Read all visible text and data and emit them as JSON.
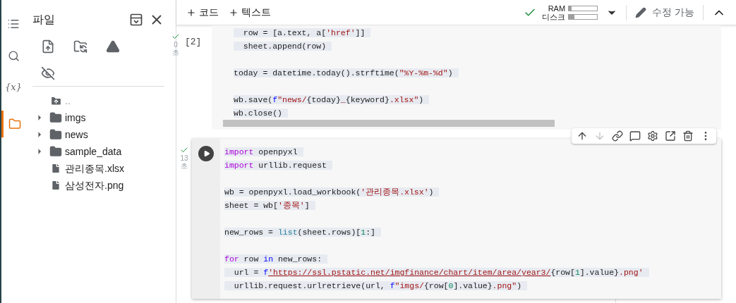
{
  "rail": [
    {
      "kind": "toc",
      "selected": false
    },
    {
      "kind": "search",
      "selected": false
    },
    {
      "kind": "variables",
      "label": "{x}",
      "selected": false
    },
    {
      "kind": "files",
      "selected": true
    }
  ],
  "files_panel": {
    "title": "파일",
    "tree": [
      {
        "kind": "parent",
        "name": ".."
      },
      {
        "kind": "folder",
        "name": "imgs",
        "expanded": false
      },
      {
        "kind": "folder",
        "name": "news",
        "expanded": false
      },
      {
        "kind": "folder",
        "name": "sample_data",
        "expanded": false
      },
      {
        "kind": "file",
        "name": "관리종목.xlsx"
      },
      {
        "kind": "file",
        "name": "삼성전자.png"
      }
    ]
  },
  "toolbar": {
    "add_code": "코드",
    "add_text": "텍스트",
    "connected": true,
    "ram": {
      "label": "RAM",
      "level": 0.1
    },
    "disk": {
      "label": "디스크",
      "level": 0.2
    },
    "editing": "수정 가능"
  },
  "cells": [
    {
      "status": "0초",
      "done": true,
      "exec_count": "[2]",
      "focused": false,
      "lines": [
        {
          "kind": "code",
          "tokens": [
            {
              "kind": "plain",
              "t": "  row = [a.text, a["
            },
            {
              "kind": "str",
              "t": "'href'"
            },
            {
              "kind": "plain",
              "t": "]]"
            }
          ]
        },
        {
          "kind": "code",
          "tokens": [
            {
              "kind": "plain",
              "t": "  sheet.append(row)"
            }
          ]
        },
        {
          "kind": "blank"
        },
        {
          "kind": "code",
          "tokens": [
            {
              "kind": "plain",
              "t": "today = datetime.today().strftime("
            },
            {
              "kind": "str",
              "t": "\"%Y-%m-%d\""
            },
            {
              "kind": "plain",
              "t": ")"
            }
          ]
        },
        {
          "kind": "blank"
        },
        {
          "kind": "code",
          "tokens": [
            {
              "kind": "plain",
              "t": "wb.save("
            },
            {
              "kind": "kw2",
              "t": "f"
            },
            {
              "kind": "str",
              "t": "\"news/"
            },
            {
              "kind": "plain",
              "t": "{today}"
            },
            {
              "kind": "str",
              "t": "_"
            },
            {
              "kind": "plain",
              "t": "{keyword}"
            },
            {
              "kind": "str",
              "t": ".xlsx\""
            },
            {
              "kind": "plain",
              "t": ")"
            }
          ]
        },
        {
          "kind": "code",
          "tokens": [
            {
              "kind": "plain",
              "t": "wb.close()"
            }
          ]
        }
      ]
    },
    {
      "status": "13초",
      "done": true,
      "focused": true,
      "lines": [
        {
          "kind": "code",
          "tokens": [
            {
              "kind": "kw",
              "t": "import"
            },
            {
              "kind": "plain",
              "t": " openpyxl"
            }
          ]
        },
        {
          "kind": "code",
          "tokens": [
            {
              "kind": "kw",
              "t": "import"
            },
            {
              "kind": "plain",
              "t": " urllib.request"
            }
          ]
        },
        {
          "kind": "blank"
        },
        {
          "kind": "code",
          "tokens": [
            {
              "kind": "plain",
              "t": "wb = openpyxl.load_workbook("
            },
            {
              "kind": "str",
              "t": "'관리종목.xlsx'"
            },
            {
              "kind": "plain",
              "t": ")"
            }
          ]
        },
        {
          "kind": "code",
          "tokens": [
            {
              "kind": "plain",
              "t": "sheet = wb["
            },
            {
              "kind": "str",
              "t": "'종목'"
            },
            {
              "kind": "plain",
              "t": "]"
            }
          ]
        },
        {
          "kind": "blank"
        },
        {
          "kind": "code",
          "tokens": [
            {
              "kind": "plain",
              "t": "new_rows = "
            },
            {
              "kind": "builtin",
              "t": "list"
            },
            {
              "kind": "plain",
              "t": "(sheet.rows)["
            },
            {
              "kind": "num",
              "t": "1"
            },
            {
              "kind": "plain",
              "t": ":]"
            }
          ]
        },
        {
          "kind": "blank"
        },
        {
          "kind": "code",
          "tokens": [
            {
              "kind": "kw",
              "t": "for"
            },
            {
              "kind": "plain",
              "t": " row "
            },
            {
              "kind": "kw2",
              "t": "in"
            },
            {
              "kind": "plain",
              "t": " new_rows:"
            }
          ]
        },
        {
          "kind": "code",
          "tokens": [
            {
              "kind": "plain",
              "t": "  url = "
            },
            {
              "kind": "kw2",
              "t": "f"
            },
            {
              "kind": "link",
              "t": "'https://ssl.pstatic.net/imgfinance/chart/item/area/year3/"
            },
            {
              "kind": "plain",
              "t": "{row["
            },
            {
              "kind": "num",
              "t": "1"
            },
            {
              "kind": "plain",
              "t": "].value}"
            },
            {
              "kind": "str",
              "t": ".png'"
            }
          ]
        },
        {
          "kind": "code",
          "tokens": [
            {
              "kind": "plain",
              "t": "  urllib.request.urlretrieve(url, "
            },
            {
              "kind": "kw2",
              "t": "f"
            },
            {
              "kind": "str",
              "t": "\"imgs/"
            },
            {
              "kind": "plain",
              "t": "{row["
            },
            {
              "kind": "num",
              "t": "0"
            },
            {
              "kind": "plain",
              "t": "].value}"
            },
            {
              "kind": "str",
              "t": ".png\""
            },
            {
              "kind": "plain",
              "t": ")"
            }
          ]
        }
      ]
    }
  ],
  "cell_toolbar": [
    {
      "kind": "up",
      "disabled": false
    },
    {
      "kind": "down",
      "disabled": true
    },
    {
      "kind": "link",
      "disabled": false
    },
    {
      "kind": "comment",
      "disabled": false
    },
    {
      "kind": "settings",
      "disabled": false
    },
    {
      "kind": "mirror",
      "disabled": false
    },
    {
      "kind": "delete",
      "disabled": false
    },
    {
      "kind": "more",
      "disabled": false
    }
  ]
}
